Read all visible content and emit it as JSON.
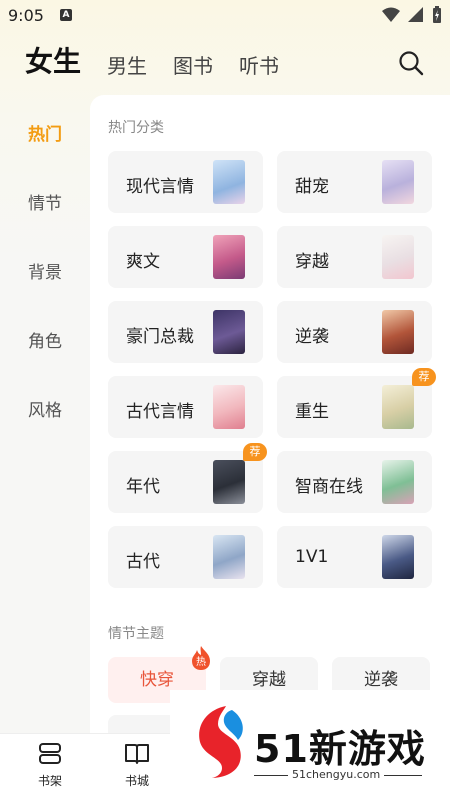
{
  "status": {
    "time": "9:05",
    "notif_badge": "A"
  },
  "tabs": [
    {
      "label": "女生",
      "active": true
    },
    {
      "label": "男生"
    },
    {
      "label": "图书"
    },
    {
      "label": "听书"
    }
  ],
  "sidebar": {
    "items": [
      {
        "label": "热门",
        "active": true
      },
      {
        "label": "情节"
      },
      {
        "label": "背景"
      },
      {
        "label": "角色"
      },
      {
        "label": "风格"
      }
    ]
  },
  "hot": {
    "title": "热门分类",
    "categories": [
      {
        "label": "现代言情"
      },
      {
        "label": "甜宠"
      },
      {
        "label": "爽文"
      },
      {
        "label": "穿越"
      },
      {
        "label": "豪门总裁"
      },
      {
        "label": "逆袭"
      },
      {
        "label": "古代言情"
      },
      {
        "label": "重生",
        "badge": "荐"
      },
      {
        "label": "年代",
        "badge": "荐"
      },
      {
        "label": "智商在线"
      },
      {
        "label": "古代"
      },
      {
        "label": "1V1"
      }
    ]
  },
  "plot": {
    "title": "情节主题",
    "chips": [
      {
        "label": "快穿",
        "badge": "热"
      },
      {
        "label": "穿越"
      },
      {
        "label": "逆袭"
      }
    ]
  },
  "bottom_nav": [
    {
      "label": "书架"
    },
    {
      "label": "书城"
    }
  ],
  "watermark": {
    "text": "51新游戏",
    "url": "51chengyu.com"
  },
  "colors": {
    "accent": "#f39c12",
    "hot_chip_text": "#e8553a",
    "badge": "#f7931e"
  }
}
